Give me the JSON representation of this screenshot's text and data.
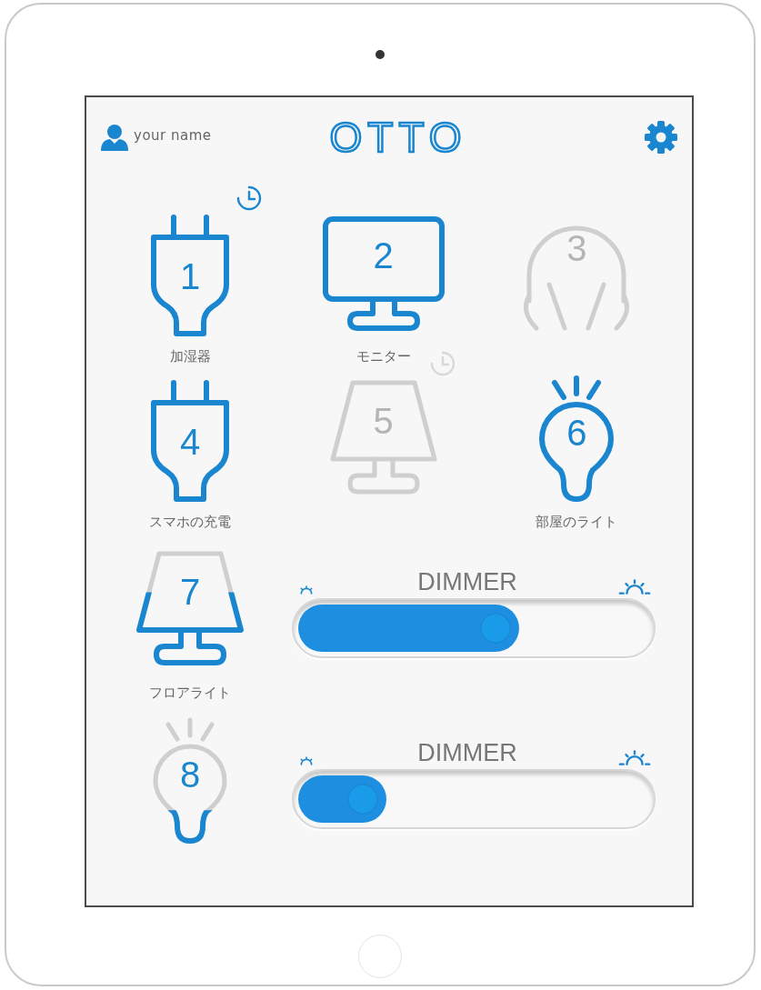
{
  "user": {
    "name": "your name"
  },
  "app": {
    "title": "OTTO"
  },
  "devices": [
    {
      "number": "1",
      "label": "加湿器",
      "kind": "plug",
      "on": true,
      "timer": true
    },
    {
      "number": "2",
      "label": "モニター",
      "kind": "monitor",
      "on": true,
      "timer": false
    },
    {
      "number": "3",
      "kind": "headphones",
      "on": false,
      "timer": false
    },
    {
      "number": "4",
      "label": "スマホの充電",
      "kind": "plug",
      "on": true,
      "timer": false
    },
    {
      "number": "5",
      "kind": "lamp",
      "on": false,
      "timer": true
    },
    {
      "number": "6",
      "label": "部屋のライト",
      "kind": "bulb",
      "on": true,
      "timer": false
    },
    {
      "number": "7",
      "label": "フロアライト",
      "kind": "lamp",
      "on": true,
      "timer": false,
      "dimmer": {
        "label": "DIMMER",
        "level": 0.64
      }
    },
    {
      "number": "8",
      "kind": "bulb",
      "on": true,
      "timer": false,
      "dimmer": {
        "label": "DIMMER",
        "level": 0.27
      }
    }
  ]
}
